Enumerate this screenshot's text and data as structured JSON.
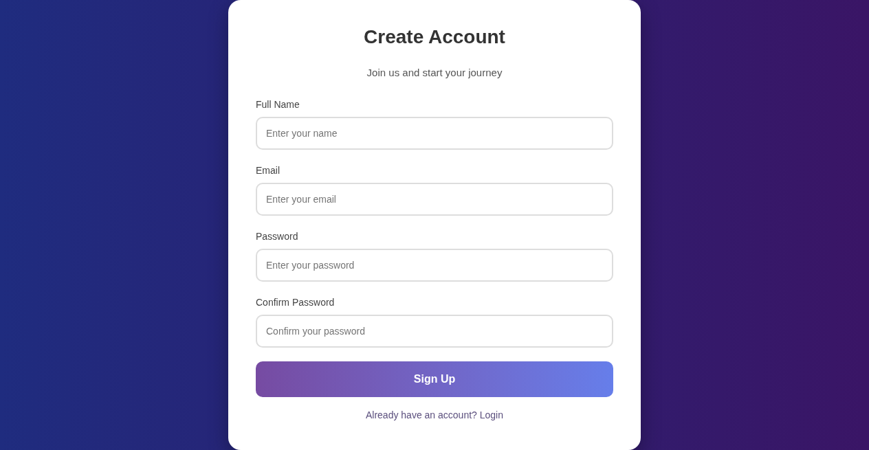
{
  "title": "Create Account",
  "subtitle": "Join us and start your journey",
  "fields": [
    {
      "label": "Full Name",
      "placeholder": "Enter your name"
    },
    {
      "label": "Email",
      "placeholder": "Enter your email"
    },
    {
      "label": "Password",
      "placeholder": "Enter your password"
    },
    {
      "label": "Confirm Password",
      "placeholder": "Confirm your password"
    }
  ],
  "submit_button": "Sign Up",
  "footer": {
    "text": "Already have an account?",
    "link": "Login"
  }
}
